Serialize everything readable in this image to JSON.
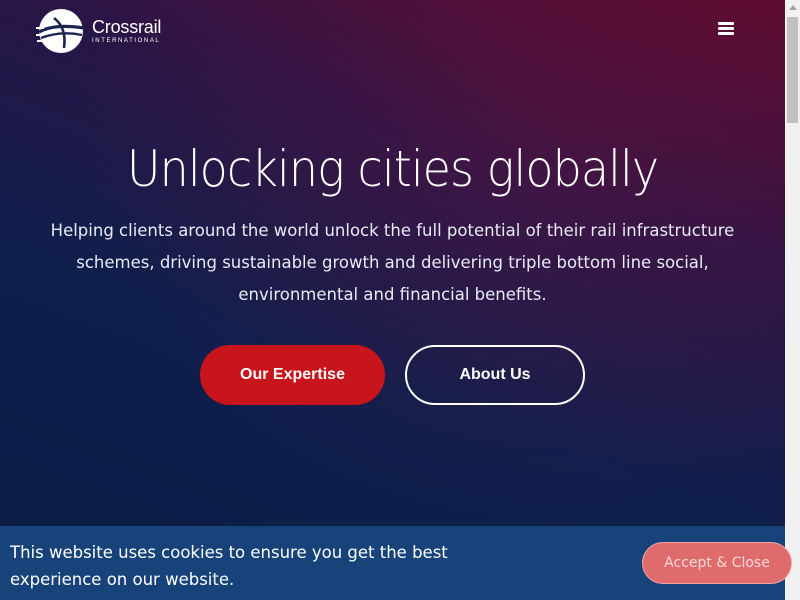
{
  "header": {
    "logo_name": "Crossrail",
    "logo_subtitle": "INTERNATIONAL",
    "menu_icon": "hamburger-menu-icon"
  },
  "hero": {
    "headline": "Unlocking cities globally",
    "lead": "Helping clients around the world unlock the full potential of their rail infrastructure schemes, driving sustainable growth and delivering triple bottom line social, environmental and financial benefits.",
    "primary_button": "Our Expertise",
    "secondary_button": "About Us"
  },
  "cookie_banner": {
    "message": "This website uses cookies to ensure you get the best experience on our website.",
    "accept_button": "Accept & Close"
  },
  "colors": {
    "accent": "#c8141b",
    "cookie_bg": "#17437a",
    "cookie_button": "#e06b6d"
  }
}
